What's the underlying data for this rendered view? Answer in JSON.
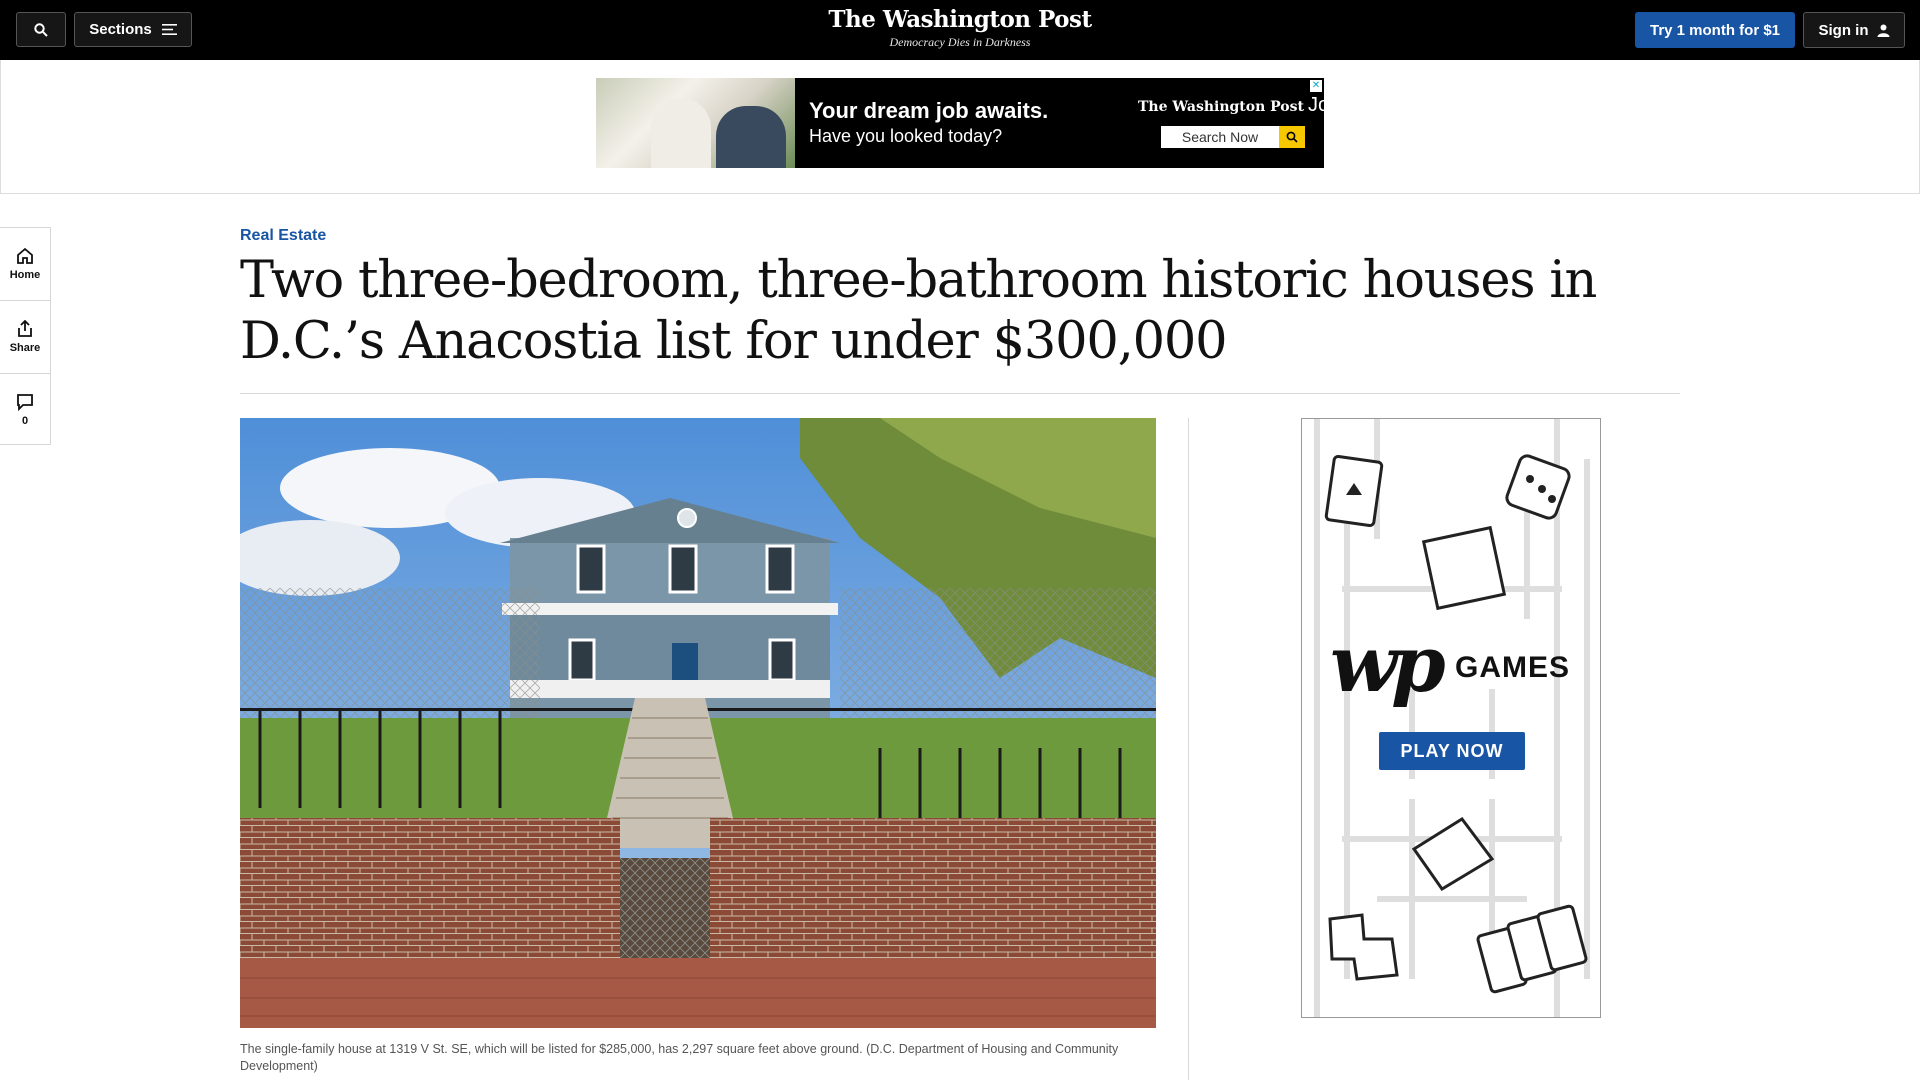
{
  "topbar": {
    "sections_label": "Sections",
    "masthead": "The Washington Post",
    "tagline": "Democracy Dies in Darkness",
    "subscribe_label": "Try 1 month for $1",
    "signin_label": "Sign in"
  },
  "top_ad": {
    "headline": "Your dream job awaits.",
    "subline": "Have you looked today?",
    "brand": "The Washington Post",
    "brand_suffix": "Jobs",
    "search_label": "Search Now"
  },
  "rail": {
    "home_label": "Home",
    "share_label": "Share",
    "comments_count": "0"
  },
  "article": {
    "kicker": "Real Estate",
    "headline": "Two three-bedroom, three-bathroom historic houses in D.C.’s Anacostia list for under $300,000",
    "caption": "The single-family house at 1319 V St. SE, which will be listed for $285,000, has 2,297 square feet above ground. (D.C. Department of Housing and Community Development)"
  },
  "games_ad": {
    "logo": "wp",
    "label": "GAMES",
    "cta": "PLAY NOW"
  },
  "colors": {
    "accent_blue": "#1955a5",
    "topbar_bg": "#000000",
    "ad_search_button": "#f7c800"
  }
}
